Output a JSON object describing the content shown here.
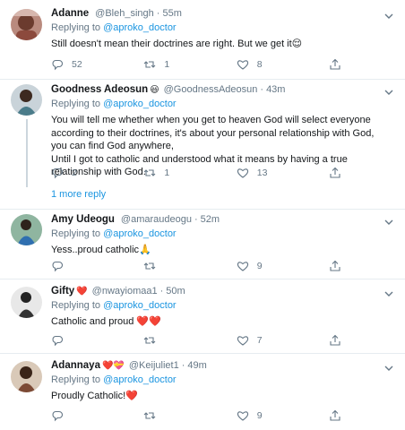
{
  "tweets": [
    {
      "name": "Adanne",
      "badge": "",
      "handle": "@Bleh_singh",
      "time": "55m",
      "replying_prefix": "Replying to",
      "replying_to": "@aproko_doctor",
      "lines": [
        "Still doesn't mean their doctrines are right. But we get it😌"
      ],
      "replies": "52",
      "retweets": "1",
      "likes": "8"
    },
    {
      "name": "Goodness Adeosun",
      "badge": "😃",
      "handle": "@GoodnessAdeosun",
      "time": "43m",
      "replying_prefix": "Replying to",
      "replying_to": "@aproko_doctor",
      "lines": [
        "You will tell me whether when you get to heaven God will select everyone",
        "according to their doctrines, it's about your personal relationship with God,",
        "you can find God anywhere,",
        "Until I got to catholic and understood what it means by having a true",
        "relationship with God."
      ],
      "replies": "2",
      "retweets": "1",
      "likes": "13"
    },
    {
      "name": "Amy Udeogu",
      "badge": "",
      "handle": "@amaraudeogu",
      "time": "52m",
      "replying_prefix": "Replying to",
      "replying_to": "@aproko_doctor",
      "lines": [
        "Yess..proud catholic🙏"
      ],
      "replies": "",
      "retweets": "",
      "likes": "9"
    },
    {
      "name": "Gifty",
      "badge": "❤️",
      "handle": "@nwayiomaa1",
      "time": "50m",
      "replying_prefix": "Replying to",
      "replying_to": "@aproko_doctor",
      "lines": [
        "Catholic and proud ❤️❤️"
      ],
      "replies": "",
      "retweets": "",
      "likes": "7"
    },
    {
      "name": "Adannaya",
      "badge": "❤️💝",
      "handle": "@Keijuliet1",
      "time": "49m",
      "replying_prefix": "Replying to",
      "replying_to": "@aproko_doctor",
      "lines": [
        "Proudly Catholic!❤️"
      ],
      "replies": "",
      "retweets": "",
      "likes": "9"
    }
  ],
  "more_replies": "1 more reply",
  "colors": {
    "link": "#1b95e0",
    "muted": "#657786",
    "text": "#14171a",
    "divider": "#e6ecf0"
  }
}
